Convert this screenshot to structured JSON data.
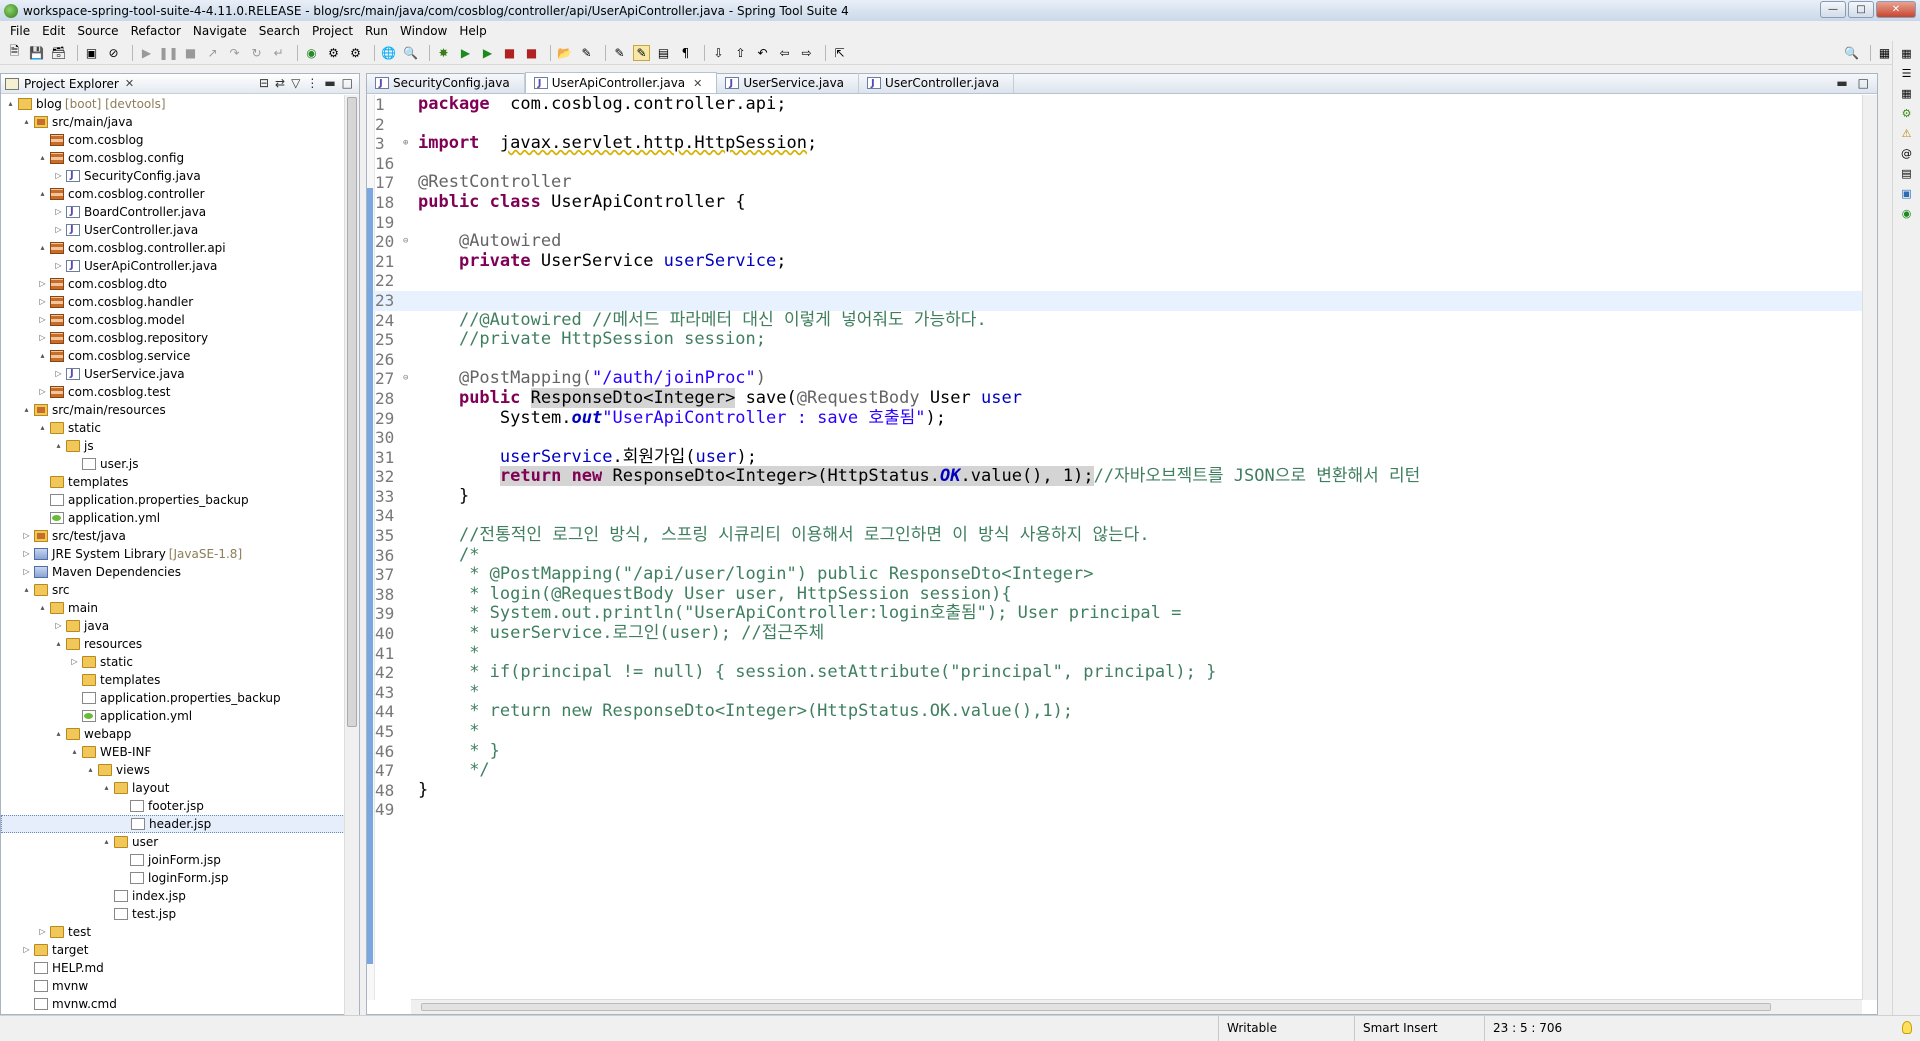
{
  "window": {
    "title": "workspace-spring-tool-suite-4-4.11.0.RELEASE - blog/src/main/java/com/cosblog/controller/api/UserApiController.java - Spring Tool Suite 4"
  },
  "menu": [
    "File",
    "Edit",
    "Source",
    "Refactor",
    "Navigate",
    "Search",
    "Project",
    "Run",
    "Window",
    "Help"
  ],
  "explorer": {
    "title": "Project Explorer",
    "items": [
      {
        "label": "blog",
        "deco": "[boot] [devtools]",
        "depth": 0,
        "tw": "▴",
        "icon": "proj"
      },
      {
        "label": "src/main/java",
        "depth": 1,
        "tw": "▴",
        "icon": "src"
      },
      {
        "label": "com.cosblog",
        "depth": 2,
        "tw": "",
        "icon": "pkg"
      },
      {
        "label": "com.cosblog.config",
        "depth": 2,
        "tw": "▴",
        "icon": "pkg"
      },
      {
        "label": "SecurityConfig.java",
        "depth": 3,
        "tw": "▷",
        "icon": "java"
      },
      {
        "label": "com.cosblog.controller",
        "depth": 2,
        "tw": "▴",
        "icon": "pkg"
      },
      {
        "label": "BoardController.java",
        "depth": 3,
        "tw": "▷",
        "icon": "java"
      },
      {
        "label": "UserController.java",
        "depth": 3,
        "tw": "▷",
        "icon": "java"
      },
      {
        "label": "com.cosblog.controller.api",
        "depth": 2,
        "tw": "▴",
        "icon": "pkg"
      },
      {
        "label": "UserApiController.java",
        "depth": 3,
        "tw": "▷",
        "icon": "java"
      },
      {
        "label": "com.cosblog.dto",
        "depth": 2,
        "tw": "▷",
        "icon": "pkg"
      },
      {
        "label": "com.cosblog.handler",
        "depth": 2,
        "tw": "▷",
        "icon": "pkg"
      },
      {
        "label": "com.cosblog.model",
        "depth": 2,
        "tw": "▷",
        "icon": "pkg"
      },
      {
        "label": "com.cosblog.repository",
        "depth": 2,
        "tw": "▷",
        "icon": "pkg"
      },
      {
        "label": "com.cosblog.service",
        "depth": 2,
        "tw": "▴",
        "icon": "pkg"
      },
      {
        "label": "UserService.java",
        "depth": 3,
        "tw": "▷",
        "icon": "java"
      },
      {
        "label": "com.cosblog.test",
        "depth": 2,
        "tw": "▷",
        "icon": "pkg"
      },
      {
        "label": "src/main/resources",
        "depth": 1,
        "tw": "▴",
        "icon": "src"
      },
      {
        "label": "static",
        "depth": 2,
        "tw": "▴",
        "icon": "folder"
      },
      {
        "label": "js",
        "depth": 3,
        "tw": "▴",
        "icon": "folder"
      },
      {
        "label": "user.js",
        "depth": 4,
        "tw": "",
        "icon": "file"
      },
      {
        "label": "templates",
        "depth": 2,
        "tw": "",
        "icon": "folder"
      },
      {
        "label": "application.properties_backup",
        "depth": 2,
        "tw": "",
        "icon": "file"
      },
      {
        "label": "application.yml",
        "depth": 2,
        "tw": "",
        "icon": "yml"
      },
      {
        "label": "src/test/java",
        "depth": 1,
        "tw": "▷",
        "icon": "src"
      },
      {
        "label": "JRE System Library",
        "deco": "[JavaSE-1.8]",
        "depth": 1,
        "tw": "▷",
        "icon": "lib"
      },
      {
        "label": "Maven Dependencies",
        "depth": 1,
        "tw": "▷",
        "icon": "lib"
      },
      {
        "label": "src",
        "depth": 1,
        "tw": "▴",
        "icon": "folder"
      },
      {
        "label": "main",
        "depth": 2,
        "tw": "▴",
        "icon": "folder"
      },
      {
        "label": "java",
        "depth": 3,
        "tw": "▷",
        "icon": "folder"
      },
      {
        "label": "resources",
        "depth": 3,
        "tw": "▴",
        "icon": "folder"
      },
      {
        "label": "static",
        "depth": 4,
        "tw": "▷",
        "icon": "folder"
      },
      {
        "label": "templates",
        "depth": 4,
        "tw": "",
        "icon": "folder"
      },
      {
        "label": "application.properties_backup",
        "depth": 4,
        "tw": "",
        "icon": "file"
      },
      {
        "label": "application.yml",
        "depth": 4,
        "tw": "",
        "icon": "yml"
      },
      {
        "label": "webapp",
        "depth": 3,
        "tw": "▴",
        "icon": "folder"
      },
      {
        "label": "WEB-INF",
        "depth": 4,
        "tw": "▴",
        "icon": "folder"
      },
      {
        "label": "views",
        "depth": 5,
        "tw": "▴",
        "icon": "folder"
      },
      {
        "label": "layout",
        "depth": 6,
        "tw": "▴",
        "icon": "folder"
      },
      {
        "label": "footer.jsp",
        "depth": 7,
        "tw": "",
        "icon": "file"
      },
      {
        "label": "header.jsp",
        "depth": 7,
        "tw": "",
        "icon": "file",
        "selected": true
      },
      {
        "label": "user",
        "depth": 6,
        "tw": "▴",
        "icon": "folder"
      },
      {
        "label": "joinForm.jsp",
        "depth": 7,
        "tw": "",
        "icon": "file"
      },
      {
        "label": "loginForm.jsp",
        "depth": 7,
        "tw": "",
        "icon": "file"
      },
      {
        "label": "index.jsp",
        "depth": 6,
        "tw": "",
        "icon": "file"
      },
      {
        "label": "test.jsp",
        "depth": 6,
        "tw": "",
        "icon": "file"
      },
      {
        "label": "test",
        "depth": 2,
        "tw": "▷",
        "icon": "folder"
      },
      {
        "label": "target",
        "depth": 1,
        "tw": "▷",
        "icon": "folder"
      },
      {
        "label": "HELP.md",
        "depth": 1,
        "tw": "",
        "icon": "file"
      },
      {
        "label": "mvnw",
        "depth": 1,
        "tw": "",
        "icon": "file"
      },
      {
        "label": "mvnw.cmd",
        "depth": 1,
        "tw": "",
        "icon": "file"
      }
    ]
  },
  "editor": {
    "tabs": [
      {
        "label": "SecurityConfig.java",
        "active": false
      },
      {
        "label": "UserApiController.java",
        "active": true
      },
      {
        "label": "UserService.java",
        "active": false
      },
      {
        "label": "UserController.java",
        "active": false
      }
    ],
    "current_line": "23",
    "lines": [
      {
        "n": "1",
        "tokens": [
          [
            "k",
            "package"
          ],
          [
            "",
            "  com.cosblog.controller.api;"
          ]
        ]
      },
      {
        "n": "2",
        "tokens": []
      },
      {
        "n": "3",
        "mark": "⊕",
        "tokens": [
          [
            "k",
            "import"
          ],
          [
            "",
            "  "
          ],
          [
            "und",
            "javax.servlet.http.HttpSession"
          ],
          [
            "",
            ";"
          ]
        ]
      },
      {
        "n": "16",
        "tokens": []
      },
      {
        "n": "17",
        "tokens": [
          [
            "an",
            "@RestController"
          ]
        ]
      },
      {
        "n": "18",
        "tokens": [
          [
            "k",
            "public"
          ],
          [
            "",
            " "
          ],
          [
            "k",
            "class"
          ],
          [
            "",
            " UserApiController {"
          ]
        ]
      },
      {
        "n": "19",
        "tokens": []
      },
      {
        "n": "20",
        "mark": "⊖",
        "tokens": [
          [
            "",
            "    "
          ],
          [
            "an",
            "@Autowired"
          ]
        ]
      },
      {
        "n": "21",
        "tokens": [
          [
            "",
            "    "
          ],
          [
            "k",
            "private"
          ],
          [
            "",
            " UserService "
          ],
          [
            "f",
            "userService"
          ],
          [
            "",
            ";"
          ]
        ]
      },
      {
        "n": "22",
        "tokens": []
      },
      {
        "n": "23",
        "tokens": []
      },
      {
        "n": "24",
        "tokens": [
          [
            "",
            "    "
          ],
          [
            "cm",
            "//@Autowired //메서드 파라메터 대신 이렇게 넣어줘도 가능하다."
          ]
        ]
      },
      {
        "n": "25",
        "tokens": [
          [
            "",
            "    "
          ],
          [
            "cm",
            "//private HttpSession session;"
          ]
        ]
      },
      {
        "n": "26",
        "tokens": []
      },
      {
        "n": "27",
        "mark": "⊖",
        "tokens": [
          [
            "",
            "    "
          ],
          [
            "an",
            "@PostMapping("
          ],
          [
            "s",
            "\"/auth/joinProc\""
          ],
          [
            "an",
            ")"
          ]
        ]
      },
      {
        "n": "28",
        "tokens": [
          [
            "",
            "    "
          ],
          [
            "k",
            "public"
          ],
          [
            "",
            " "
          ],
          [
            "hl",
            "ResponseDto<Integer>"
          ],
          [
            "",
            " save("
          ],
          [
            "an",
            "@RequestBody"
          ],
          [
            "",
            " User "
          ],
          [
            "f",
            "user"
          ],
          [
            ") {"
          ]
        ]
      },
      {
        "n": "29",
        "tokens": [
          [
            "",
            "        System."
          ],
          [
            "it",
            "out"
          ],
          [
            ".println("
          ],
          [
            "s",
            "\"UserApiController : save 호출됨\""
          ],
          [
            "",
            ");"
          ]
        ]
      },
      {
        "n": "30",
        "tokens": []
      },
      {
        "n": "31",
        "tokens": [
          [
            "",
            "        "
          ],
          [
            "f",
            "userService"
          ],
          [
            "",
            ".회원가입("
          ],
          [
            "f",
            "user"
          ],
          [
            "",
            ");"
          ]
        ]
      },
      {
        "n": "32",
        "tokens": [
          [
            "",
            "        "
          ],
          [
            "hlk",
            "return"
          ],
          [
            "hl",
            " "
          ],
          [
            "hlk",
            "new"
          ],
          [
            "hl",
            " ResponseDto<Integer>(HttpStatus."
          ],
          [
            "hlit",
            "OK"
          ],
          [
            "hl",
            ".value(), 1);"
          ],
          [
            "cm",
            "//자바오브젝트를 JSON으로 변환해서 리턴"
          ]
        ]
      },
      {
        "n": "33",
        "tokens": [
          [
            "",
            "    }"
          ]
        ]
      },
      {
        "n": "34",
        "tokens": []
      },
      {
        "n": "35",
        "tokens": [
          [
            "",
            "    "
          ],
          [
            "cm",
            "//전통적인 로그인 방식, 스프링 시큐리티 이용해서 로그인하면 이 방식 사용하지 않는다."
          ]
        ]
      },
      {
        "n": "36",
        "tokens": [
          [
            "",
            "    "
          ],
          [
            "cm",
            "/*"
          ]
        ]
      },
      {
        "n": "37",
        "tokens": [
          [
            "",
            "     "
          ],
          [
            "cm",
            "* @PostMapping(\"/api/user/login\") public ResponseDto<Integer>"
          ]
        ]
      },
      {
        "n": "38",
        "tokens": [
          [
            "",
            "     "
          ],
          [
            "cm",
            "* login(@RequestBody User user, HttpSession session){"
          ]
        ]
      },
      {
        "n": "39",
        "tokens": [
          [
            "",
            "     "
          ],
          [
            "cm",
            "* System.out.println(\"UserApiController:login호출됨\"); User principal ="
          ]
        ]
      },
      {
        "n": "40",
        "tokens": [
          [
            "",
            "     "
          ],
          [
            "cm",
            "* userService.로그인(user); //접근주체"
          ]
        ]
      },
      {
        "n": "41",
        "tokens": [
          [
            "",
            "     "
          ],
          [
            "cm",
            "*"
          ]
        ]
      },
      {
        "n": "42",
        "tokens": [
          [
            "",
            "     "
          ],
          [
            "cm",
            "* if(principal != null) { session.setAttribute(\"principal\", principal); }"
          ]
        ]
      },
      {
        "n": "43",
        "tokens": [
          [
            "",
            "     "
          ],
          [
            "cm",
            "*"
          ]
        ]
      },
      {
        "n": "44",
        "tokens": [
          [
            "",
            "     "
          ],
          [
            "cm",
            "* return new ResponseDto<Integer>(HttpStatus.OK.value(),1);"
          ]
        ]
      },
      {
        "n": "45",
        "tokens": [
          [
            "",
            "     "
          ],
          [
            "cm",
            "*"
          ]
        ]
      },
      {
        "n": "46",
        "tokens": [
          [
            "",
            "     "
          ],
          [
            "cm",
            "* }"
          ]
        ]
      },
      {
        "n": "47",
        "tokens": [
          [
            "",
            "     "
          ],
          [
            "cm",
            "*/"
          ]
        ]
      },
      {
        "n": "48",
        "tokens": [
          [
            "",
            "}"
          ]
        ]
      },
      {
        "n": "49",
        "tokens": []
      }
    ]
  },
  "status": {
    "mode": "Writable",
    "insert": "Smart Insert",
    "position": "23 : 5 : 706"
  },
  "colors": {
    "keyword": "#7f0055",
    "annotation": "#646464",
    "string": "#2a00ff",
    "field": "#0000c0",
    "comment": "#3f7f5f"
  }
}
